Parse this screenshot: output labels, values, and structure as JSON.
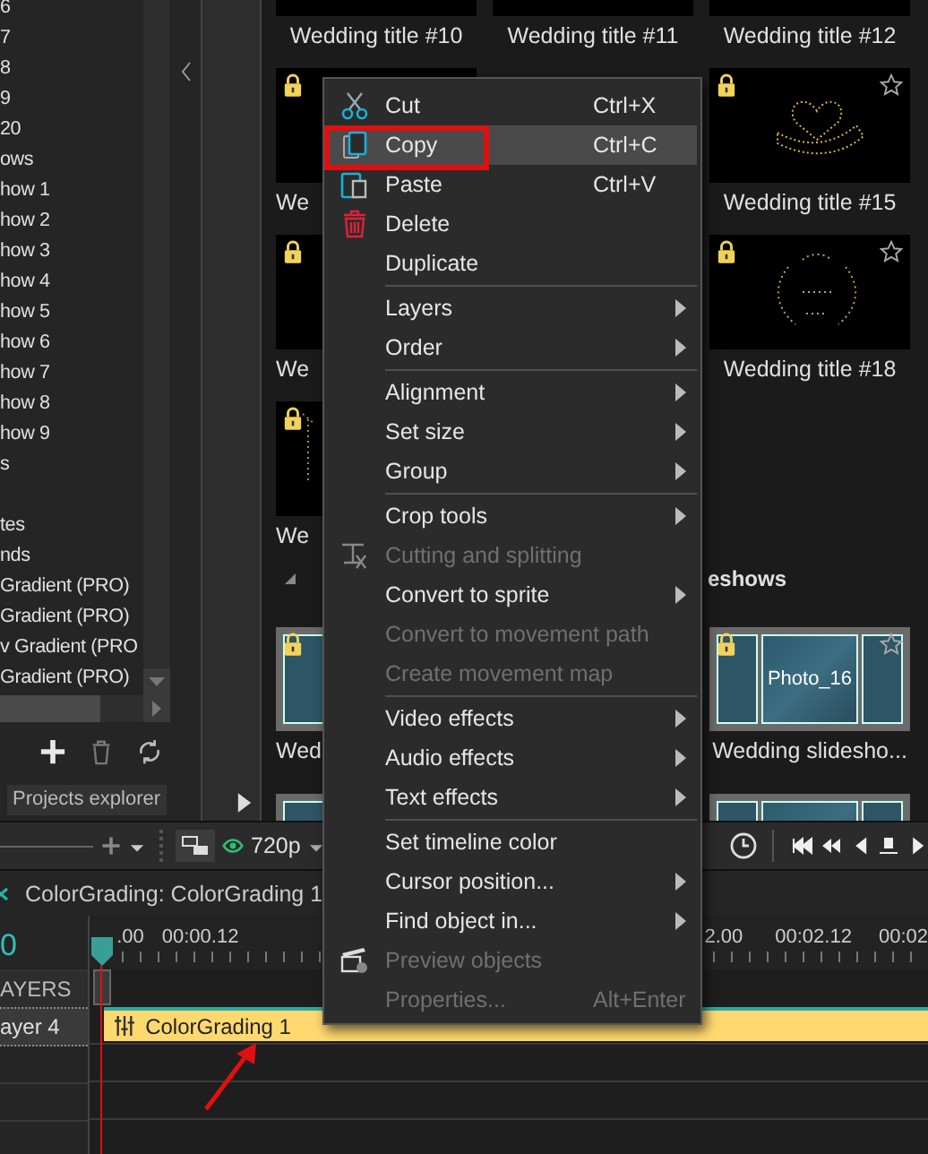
{
  "tree": {
    "items": [
      "6",
      "7",
      "8",
      "9",
      "20",
      "ows",
      "how 1",
      "how 2",
      "how 3",
      "how 4",
      "how 5",
      "how 6",
      "how 7",
      "how 8",
      "how 9",
      "s",
      "tes",
      "nds",
      "Gradient (PRO)",
      "Gradient (PRO)",
      "v Gradient (PRO",
      "Gradient (PRO)"
    ]
  },
  "explorer_tab": {
    "label": "Projects explorer"
  },
  "library": {
    "groups": [
      {
        "rows": [
          {
            "tiles": [
              {
                "label": "Wedding title #10",
                "kind": "blank"
              },
              {
                "label": "Wedding title #11",
                "kind": "blank"
              },
              {
                "label": "Wedding title #12",
                "kind": "blank"
              }
            ]
          },
          {
            "tiles": [
              {
                "label": "We",
                "kind": "blank",
                "locked": true
              },
              {
                "label": "Wedding title #15",
                "kind": "heart",
                "locked": true,
                "favorite": false
              }
            ]
          },
          {
            "tiles": [
              {
                "label": "We",
                "kind": "blank",
                "locked": true
              },
              {
                "label": "Wedding title #18",
                "kind": "wreath",
                "locked": true,
                "favorite": false
              }
            ]
          },
          {
            "tiles": [
              {
                "label": "We",
                "kind": "sparkle",
                "locked": true
              }
            ]
          }
        ]
      },
      {
        "title": "eshows",
        "expanded": true,
        "rows": [
          {
            "tiles": [
              {
                "label": "Wed",
                "kind": "collage",
                "locked": true
              },
              {
                "label": "Wedding slidesho...",
                "kind": "collage",
                "caption": "Photo_16",
                "locked": true,
                "favorite": false
              }
            ]
          },
          {
            "tiles": [
              {
                "kind": "collage"
              },
              {
                "kind": "collage"
              }
            ]
          }
        ]
      }
    ]
  },
  "context_menu": {
    "items": [
      {
        "kind": "item",
        "label": "Cut",
        "shortcut": "Ctrl+X",
        "selected": false,
        "disabled": false,
        "submenu": false
      },
      {
        "kind": "item",
        "label": "Copy",
        "shortcut": "Ctrl+C",
        "selected": true,
        "disabled": false,
        "submenu": false
      },
      {
        "kind": "item",
        "label": "Paste",
        "shortcut": "Ctrl+V",
        "selected": false,
        "disabled": false,
        "submenu": false
      },
      {
        "kind": "item",
        "label": "Delete",
        "selected": false,
        "disabled": false,
        "submenu": false
      },
      {
        "kind": "item",
        "label": "Duplicate",
        "selected": false,
        "disabled": false,
        "submenu": false
      },
      {
        "kind": "separator"
      },
      {
        "kind": "item",
        "label": "Layers",
        "selected": false,
        "disabled": false,
        "submenu": true
      },
      {
        "kind": "item",
        "label": "Order",
        "selected": false,
        "disabled": false,
        "submenu": true
      },
      {
        "kind": "separator"
      },
      {
        "kind": "item",
        "label": "Alignment",
        "selected": false,
        "disabled": false,
        "submenu": true
      },
      {
        "kind": "item",
        "label": "Set size",
        "selected": false,
        "disabled": false,
        "submenu": true
      },
      {
        "kind": "item",
        "label": "Group",
        "selected": false,
        "disabled": false,
        "submenu": true
      },
      {
        "kind": "separator"
      },
      {
        "kind": "item",
        "label": "Crop tools",
        "selected": false,
        "disabled": false,
        "submenu": true
      },
      {
        "kind": "item",
        "label": "Cutting and splitting",
        "selected": false,
        "disabled": true,
        "submenu": false
      },
      {
        "kind": "item",
        "label": "Convert to sprite",
        "selected": false,
        "disabled": false,
        "submenu": true
      },
      {
        "kind": "item",
        "label": "Convert to movement path",
        "selected": false,
        "disabled": true,
        "submenu": false
      },
      {
        "kind": "item",
        "label": "Create movement map",
        "selected": false,
        "disabled": true,
        "submenu": false
      },
      {
        "kind": "separator"
      },
      {
        "kind": "item",
        "label": "Video effects",
        "selected": false,
        "disabled": false,
        "submenu": true
      },
      {
        "kind": "item",
        "label": "Audio effects",
        "selected": false,
        "disabled": false,
        "submenu": true
      },
      {
        "kind": "item",
        "label": "Text effects",
        "selected": false,
        "disabled": false,
        "submenu": true
      },
      {
        "kind": "separator"
      },
      {
        "kind": "item",
        "label": "Set timeline color",
        "selected": false,
        "disabled": false,
        "submenu": false
      },
      {
        "kind": "item",
        "label": "Cursor position...",
        "selected": false,
        "disabled": false,
        "submenu": true
      },
      {
        "kind": "item",
        "label": "Find object in...",
        "selected": false,
        "disabled": false,
        "submenu": true
      },
      {
        "kind": "item",
        "label": "Preview objects",
        "selected": false,
        "disabled": true,
        "submenu": false
      },
      {
        "kind": "item",
        "label": "Properties...",
        "shortcut": "Alt+Enter",
        "selected": false,
        "disabled": true,
        "submenu": false
      }
    ]
  },
  "toolbar": {
    "resolution": "720p"
  },
  "timeline": {
    "tab": "ColorGrading: ColorGrading 1",
    "time": "0",
    "header": "AYERS",
    "ruler": [
      ".00",
      "00:00.12",
      "2.00",
      "00:02.12",
      "00:02"
    ],
    "layers": [
      {
        "name": "ayer 4",
        "clip": "ColorGrading 1"
      }
    ]
  }
}
